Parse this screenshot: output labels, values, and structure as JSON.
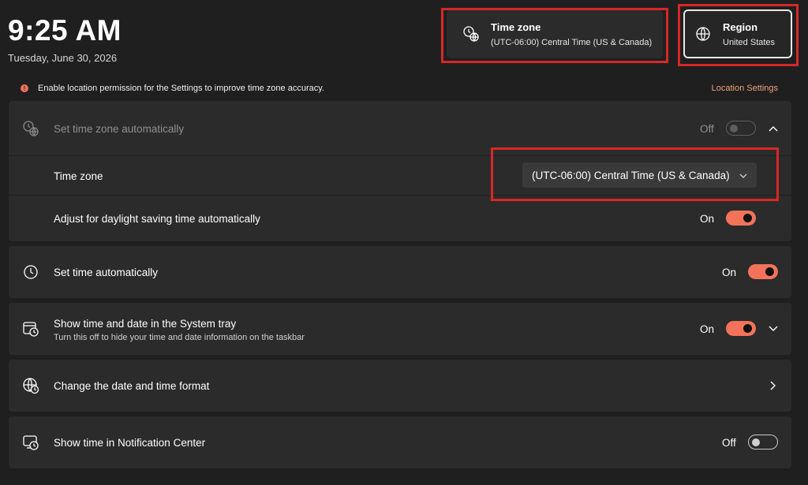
{
  "header": {
    "time": "9:25 AM",
    "date": "Tuesday, June 30, 2026"
  },
  "cards": {
    "timezone": {
      "title": "Time zone",
      "value": "(UTC-06:00) Central Time (US & Canada)",
      "icon": "clock-globe-icon"
    },
    "region": {
      "title": "Region",
      "value": "United States",
      "icon": "globe-icon"
    }
  },
  "banner": {
    "message": "Enable location permission for the Settings to improve time zone accuracy.",
    "link": "Location Settings",
    "icon": "warning-icon"
  },
  "settings": {
    "auto_timezone": {
      "label": "Set time zone automatically",
      "state": "Off",
      "enabled": false
    },
    "timezone": {
      "label": "Time zone",
      "selected": "(UTC-06:00) Central Time (US & Canada)"
    },
    "daylight": {
      "label": "Adjust for daylight saving time automatically",
      "state": "On"
    },
    "auto_time": {
      "label": "Set time automatically",
      "state": "On"
    },
    "systray": {
      "label": "Show time and date in the System tray",
      "sub": "Turn this off to hide your time and date information on the taskbar",
      "state": "On"
    },
    "format": {
      "label": "Change the date and time format"
    },
    "notification": {
      "label": "Show time in Notification Center",
      "state": "Off"
    }
  },
  "colors": {
    "accent": "#f3735a",
    "highlight": "#d62828",
    "background": "#1f1f1f",
    "card": "#2b2b2b"
  }
}
